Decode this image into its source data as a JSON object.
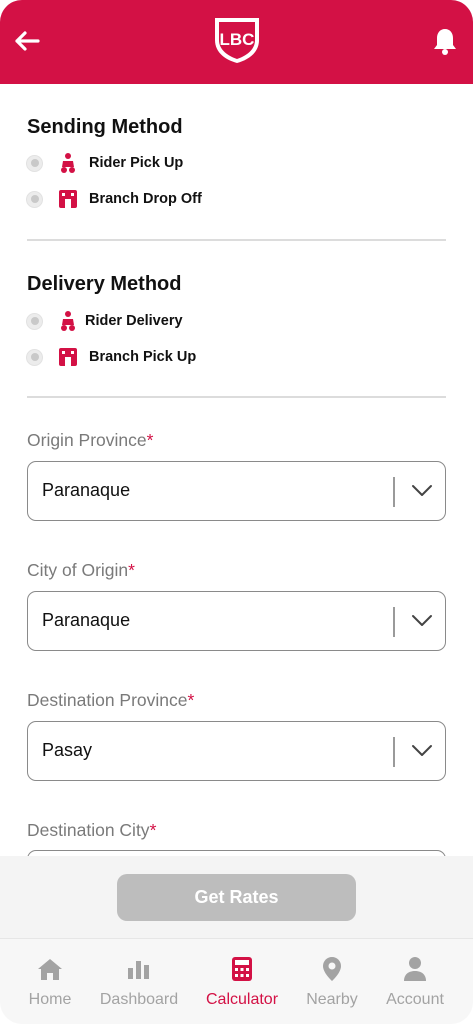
{
  "colors": {
    "brand": "#d31145",
    "disabled_button": "#bdbdbd",
    "muted_text": "#7a7a7a"
  },
  "header": {
    "logo_text": "LBC",
    "back_icon": "arrow-left-icon",
    "bell_icon": "bell-icon"
  },
  "sending": {
    "title": "Sending Method",
    "options": [
      {
        "label": "Rider Pick Up",
        "icon": "scooter-icon",
        "selected": false
      },
      {
        "label": "Branch Drop Off",
        "icon": "branch-icon",
        "selected": false
      }
    ]
  },
  "delivery": {
    "title": "Delivery Method",
    "options": [
      {
        "label": "Rider Delivery",
        "icon": "scooter-icon",
        "selected": false
      },
      {
        "label": "Branch Pick Up",
        "icon": "branch-icon",
        "selected": false
      }
    ]
  },
  "fields": {
    "origin_province": {
      "label": "Origin Province",
      "required": "*",
      "value": "Paranaque"
    },
    "city_of_origin": {
      "label": "City of Origin",
      "required": "*",
      "value": "Paranaque"
    },
    "destination_province": {
      "label": "Destination Province",
      "required": "*",
      "value": "Pasay"
    },
    "destination_city": {
      "label": "Destination City",
      "required": "*",
      "value": ""
    }
  },
  "actions": {
    "get_rates": "Get Rates"
  },
  "nav": {
    "items": [
      {
        "label": "Home",
        "icon": "home-icon",
        "active": false
      },
      {
        "label": "Dashboard",
        "icon": "bar-chart-icon",
        "active": false
      },
      {
        "label": "Calculator",
        "icon": "calculator-icon",
        "active": true
      },
      {
        "label": "Nearby",
        "icon": "location-pin-icon",
        "active": false
      },
      {
        "label": "Account",
        "icon": "user-icon",
        "active": false
      }
    ]
  }
}
